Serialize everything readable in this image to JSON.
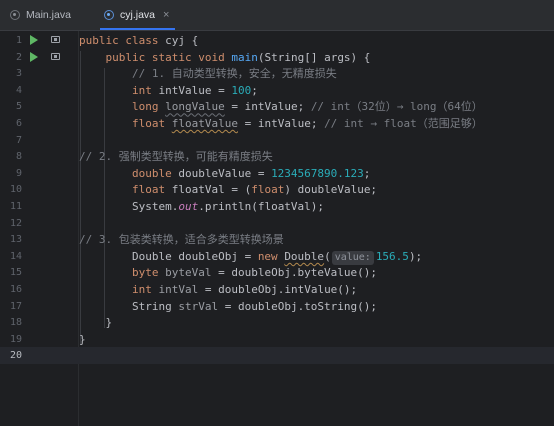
{
  "tabs": [
    {
      "label": "Main.java",
      "active": false
    },
    {
      "label": "cyj.java",
      "active": true,
      "close": "×"
    }
  ],
  "lines": [
    {
      "n": "1",
      "run": true,
      "bookmark": true,
      "parts": [
        [
          "kw",
          "public class "
        ],
        [
          "",
          "cyj {"
        ]
      ]
    },
    {
      "n": "2",
      "run": true,
      "bookmark": true,
      "parts": [
        [
          "",
          "    "
        ],
        [
          "kw",
          "public static void "
        ],
        [
          "fn",
          "main"
        ],
        [
          "",
          "(String[] args) {"
        ]
      ]
    },
    {
      "n": "3",
      "parts": [
        [
          "",
          "        "
        ],
        [
          "cm",
          "// 1. 自动类型转换，安全，无精度损失"
        ]
      ]
    },
    {
      "n": "4",
      "parts": [
        [
          "",
          "        "
        ],
        [
          "kw",
          "int "
        ],
        [
          "",
          "intValue = "
        ],
        [
          "num",
          "100"
        ],
        [
          "",
          ";"
        ]
      ]
    },
    {
      "n": "5",
      "parts": [
        [
          "",
          "        "
        ],
        [
          "kw",
          "long "
        ],
        [
          "unused wavy-unused",
          "longValue"
        ],
        [
          "",
          " = intValue; "
        ],
        [
          "cm",
          "// int（32位）→ long（64位）"
        ]
      ]
    },
    {
      "n": "6",
      "parts": [
        [
          "",
          "        "
        ],
        [
          "kw",
          "float "
        ],
        [
          "unused wavy",
          "floatValue"
        ],
        [
          "",
          " = intValue; "
        ],
        [
          "cm",
          "// int → float（范围足够）"
        ]
      ]
    },
    {
      "n": "7",
      "parts": []
    },
    {
      "n": "8",
      "parts": [
        [
          "cm",
          "// 2. 强制类型转换，可能有精度损失"
        ]
      ]
    },
    {
      "n": "9",
      "parts": [
        [
          "",
          "        "
        ],
        [
          "kw",
          "double "
        ],
        [
          "",
          "doubleValue = "
        ],
        [
          "num",
          "1234567890.123"
        ],
        [
          "",
          ";"
        ]
      ]
    },
    {
      "n": "10",
      "parts": [
        [
          "",
          "        "
        ],
        [
          "kw",
          "float "
        ],
        [
          "",
          "floatVal = ("
        ],
        [
          "kw",
          "float"
        ],
        [
          "",
          ") doubleValue;"
        ]
      ]
    },
    {
      "n": "11",
      "parts": [
        [
          "",
          "        System."
        ],
        [
          "ital",
          "out"
        ],
        [
          "",
          ".println(floatVal);"
        ]
      ]
    },
    {
      "n": "12",
      "parts": []
    },
    {
      "n": "13",
      "parts": [
        [
          "cm",
          "// 3. 包装类转换，适合多类型转换场景"
        ]
      ]
    },
    {
      "n": "14",
      "parts": [
        [
          "",
          "        Double doubleObj = "
        ],
        [
          "kw",
          "new "
        ],
        [
          "wavy",
          "Double"
        ],
        [
          "",
          "("
        ],
        [
          "hint",
          "value:"
        ],
        [
          "num",
          "156.5"
        ],
        [
          "",
          ");"
        ]
      ]
    },
    {
      "n": "15",
      "parts": [
        [
          "",
          "        "
        ],
        [
          "kw",
          "byte "
        ],
        [
          "unused",
          "byteVal"
        ],
        [
          "",
          " = doubleObj.byteValue();"
        ]
      ]
    },
    {
      "n": "16",
      "parts": [
        [
          "",
          "        "
        ],
        [
          "kw",
          "int "
        ],
        [
          "unused",
          "intVal"
        ],
        [
          "",
          " = doubleObj.intValue();"
        ]
      ]
    },
    {
      "n": "17",
      "parts": [
        [
          "",
          "        String "
        ],
        [
          "unused",
          "strVal"
        ],
        [
          "",
          " = doubleObj.toString();"
        ]
      ]
    },
    {
      "n": "18",
      "parts": [
        [
          "",
          "    }"
        ]
      ]
    },
    {
      "n": "19",
      "parts": [
        [
          "",
          "}"
        ]
      ]
    },
    {
      "n": "20",
      "current": true,
      "parts": []
    }
  ]
}
